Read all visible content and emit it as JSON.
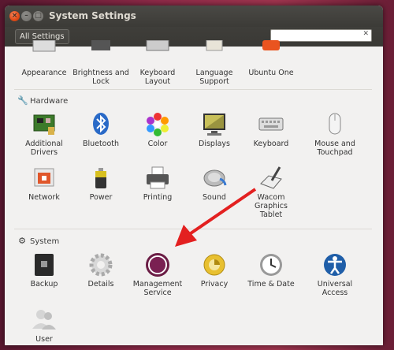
{
  "window": {
    "title": "System Settings",
    "all_settings_label": "All Settings",
    "search_placeholder": "",
    "search_clear_glyph": "✕"
  },
  "personal": [
    {
      "label": "Appearance",
      "icon": "appearance-icon"
    },
    {
      "label": "Brightness and Lock",
      "icon": "brightness-icon"
    },
    {
      "label": "Keyboard Layout",
      "icon": "keyboard-layout-icon"
    },
    {
      "label": "Language Support",
      "icon": "language-icon"
    },
    {
      "label": "Ubuntu One",
      "icon": "ubuntu-one-icon"
    }
  ],
  "hardware": {
    "title": "Hardware",
    "items": [
      {
        "label": "Additional Drivers",
        "icon": "drivers-icon"
      },
      {
        "label": "Bluetooth",
        "icon": "bluetooth-icon"
      },
      {
        "label": "Color",
        "icon": "color-icon"
      },
      {
        "label": "Displays",
        "icon": "displays-icon"
      },
      {
        "label": "Keyboard",
        "icon": "keyboard-icon"
      },
      {
        "label": "Mouse and Touchpad",
        "icon": "mouse-icon"
      },
      {
        "label": "Network",
        "icon": "network-icon"
      },
      {
        "label": "Power",
        "icon": "power-icon"
      },
      {
        "label": "Printing",
        "icon": "printer-icon"
      },
      {
        "label": "Sound",
        "icon": "sound-icon"
      },
      {
        "label": "Wacom Graphics Tablet",
        "icon": "wacom-icon"
      }
    ]
  },
  "system": {
    "title": "System",
    "items": [
      {
        "label": "Backup",
        "icon": "backup-icon"
      },
      {
        "label": "Details",
        "icon": "details-icon"
      },
      {
        "label": "Management Service",
        "icon": "management-icon"
      },
      {
        "label": "Privacy",
        "icon": "privacy-icon"
      },
      {
        "label": "Time & Date",
        "icon": "clock-icon"
      },
      {
        "label": "Universal Access",
        "icon": "accessibility-icon"
      },
      {
        "label": "User",
        "icon": "users-icon"
      }
    ]
  },
  "colors": {
    "desktop": "#7a2240",
    "titlebar": "#3c3b37",
    "window_bg": "#f2f1f0",
    "arrow": "#e32020",
    "management_ring": "#6b1d45"
  }
}
